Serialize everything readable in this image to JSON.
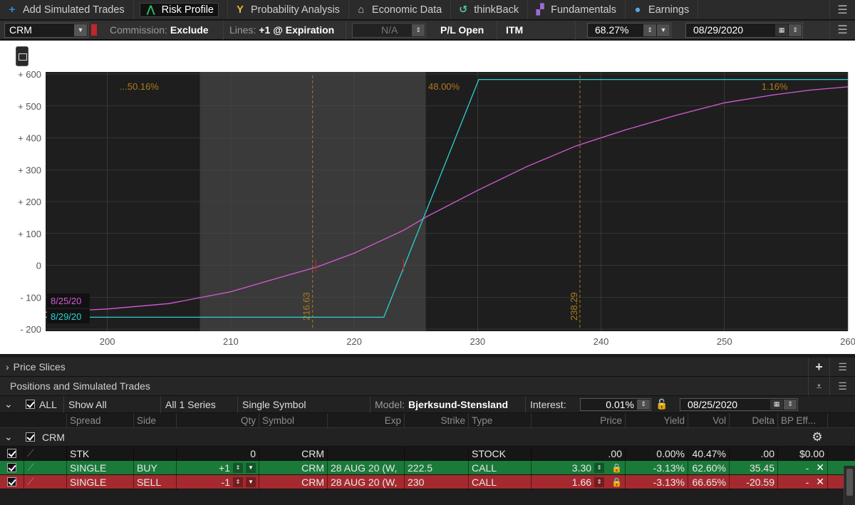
{
  "tabs": [
    {
      "label": "Add Simulated Trades",
      "icon": "plus-icon",
      "color": "#2f8fd8",
      "glyph": "+"
    },
    {
      "label": "Risk Profile",
      "icon": "risk-profile-icon",
      "color": "#2fbf5a",
      "glyph": "⋀",
      "active": true
    },
    {
      "label": "Probability Analysis",
      "icon": "probability-icon",
      "color": "#e0c040",
      "glyph": "Y"
    },
    {
      "label": "Economic Data",
      "icon": "bank-icon",
      "color": "#cccccc",
      "glyph": "⌂"
    },
    {
      "label": "thinkBack",
      "icon": "history-icon",
      "color": "#55c4a0",
      "glyph": "↺"
    },
    {
      "label": "Fundamentals",
      "icon": "fundamentals-icon",
      "color": "#9b6bd6",
      "glyph": "▞"
    },
    {
      "label": "Earnings",
      "icon": "lightbulb-icon",
      "color": "#58a8e8",
      "glyph": "●"
    }
  ],
  "controls": {
    "symbol": "CRM",
    "commission_label": "Commission:",
    "commission_value": "Exclude",
    "lines_label": "Lines:",
    "lines_value": "+1 @ Expiration",
    "na_value": "N/A",
    "pl_mode": "P/L Open",
    "itm": "ITM",
    "percent": "68.27%",
    "date": "08/29/2020"
  },
  "chart_data": {
    "type": "line",
    "xlim": [
      195,
      260
    ],
    "ylim": [
      -200,
      600
    ],
    "x_ticks": [
      200,
      210,
      220,
      230,
      240,
      250,
      260
    ],
    "x_tick_labels": [
      "200",
      "210",
      "220",
      "230",
      "240",
      "250",
      "260"
    ],
    "y_ticks": [
      600,
      500,
      400,
      300,
      200,
      100,
      0,
      -100,
      -200
    ],
    "y_tick_labels": [
      "+ 600",
      "+ 500",
      "+ 400",
      "+ 300",
      "+ 200",
      "+ 100",
      "0",
      "- 100",
      "- 200"
    ],
    "grid": true,
    "zones": [
      {
        "from": 195,
        "to": 207.5,
        "shade": "dark"
      },
      {
        "from": 207.5,
        "to": 225.8,
        "shade": "light"
      },
      {
        "from": 225.8,
        "to": 260,
        "shade": "dark"
      }
    ],
    "probability_labels": [
      {
        "text": "...50.16%",
        "x": 201
      },
      {
        "text": "48.00%",
        "x": 226
      },
      {
        "text": "1.16%",
        "x": 253
      }
    ],
    "markers": [
      {
        "x": 216.63,
        "label": "216.63"
      },
      {
        "x": 238.29,
        "label": "238.29"
      }
    ],
    "series": [
      {
        "name": "8/25/20",
        "color": "#d85ad8",
        "points": [
          [
            195,
            -147
          ],
          [
            200,
            -137
          ],
          [
            205,
            -120
          ],
          [
            210,
            -83
          ],
          [
            214,
            -38
          ],
          [
            217,
            -5
          ],
          [
            220,
            38
          ],
          [
            224,
            110
          ],
          [
            226,
            155
          ],
          [
            230,
            235
          ],
          [
            234,
            310
          ],
          [
            238,
            375
          ],
          [
            242,
            425
          ],
          [
            246,
            470
          ],
          [
            250,
            510
          ],
          [
            254,
            535
          ],
          [
            257,
            550
          ],
          [
            260,
            560
          ]
        ]
      },
      {
        "name": "8/29/20",
        "color": "#2fd0d0",
        "points": [
          [
            195,
            -163
          ],
          [
            222.4,
            -163
          ],
          [
            230.1,
            583
          ],
          [
            260,
            583
          ]
        ]
      }
    ]
  },
  "sections": {
    "price_slices": "Price Slices",
    "positions": "Positions and Simulated Trades"
  },
  "filter": {
    "all": "ALL",
    "show_all": "Show All",
    "series": "All 1 Series",
    "symbol_mode": "Single Symbol",
    "model_label": "Model:",
    "model_value": "Bjerksund-Stensland",
    "interest_label": "Interest:",
    "interest_value": "0.01%",
    "date": "08/25/2020"
  },
  "columns": [
    "Spread",
    "Side",
    "Qty",
    "Symbol",
    "Exp",
    "Strike",
    "Type",
    "Price",
    "Yield",
    "Vol",
    "Delta",
    "BP Eff..."
  ],
  "group": "CRM",
  "rows": [
    {
      "kind": "stk",
      "spread": "STK",
      "side": "",
      "qty": "0",
      "symbol": "CRM",
      "exp": "",
      "strike": "",
      "type": "STOCK",
      "price": ".00",
      "yield": "0.00%",
      "vol": "40.47%",
      "delta": ".00",
      "bp": "$0.00"
    },
    {
      "kind": "buy",
      "spread": "SINGLE",
      "side": "BUY",
      "qty": "+1",
      "symbol": "CRM",
      "exp": "28 AUG 20 (W,",
      "strike": "222.5",
      "type": "CALL",
      "price": "3.30",
      "yield": "-3.13%",
      "vol": "62.60%",
      "delta": "35.45",
      "bp": "-"
    },
    {
      "kind": "sell",
      "spread": "SINGLE",
      "side": "SELL",
      "qty": "-1",
      "symbol": "CRM",
      "exp": "28 AUG 20 (W,",
      "strike": "230",
      "type": "CALL",
      "price": "1.66",
      "yield": "-3.13%",
      "vol": "66.65%",
      "delta": "-20.59",
      "bp": "-"
    }
  ]
}
